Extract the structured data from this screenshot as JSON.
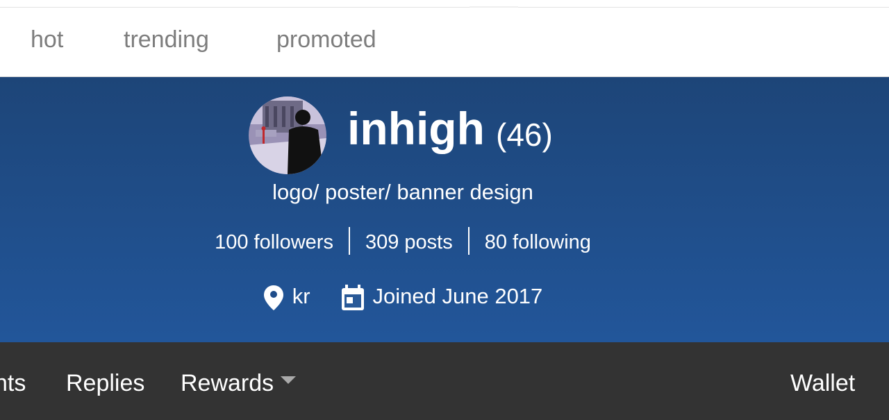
{
  "nav": {
    "items": [
      {
        "label": "hot"
      },
      {
        "label": "trending"
      },
      {
        "label": "promoted"
      }
    ]
  },
  "profile": {
    "username": "inhigh",
    "reputation": "(46)",
    "tagline": "logo/ poster/ banner design",
    "stats": {
      "followers": "100 followers",
      "posts": "309 posts",
      "following": "80 following"
    },
    "location": "kr",
    "joined": "Joined June 2017",
    "icons": {
      "location": "location-pin-icon",
      "calendar": "calendar-icon"
    }
  },
  "tabs": {
    "items": [
      {
        "label": "nts"
      },
      {
        "label": "Replies"
      },
      {
        "label": "Rewards"
      }
    ],
    "right": "Wallet",
    "dropdown_icon": "caret-down-icon"
  },
  "colors": {
    "hero_top": "#1d4578",
    "hero_bottom": "#22569a",
    "tabbar": "#333333",
    "nav_text": "#7d7d7d"
  }
}
